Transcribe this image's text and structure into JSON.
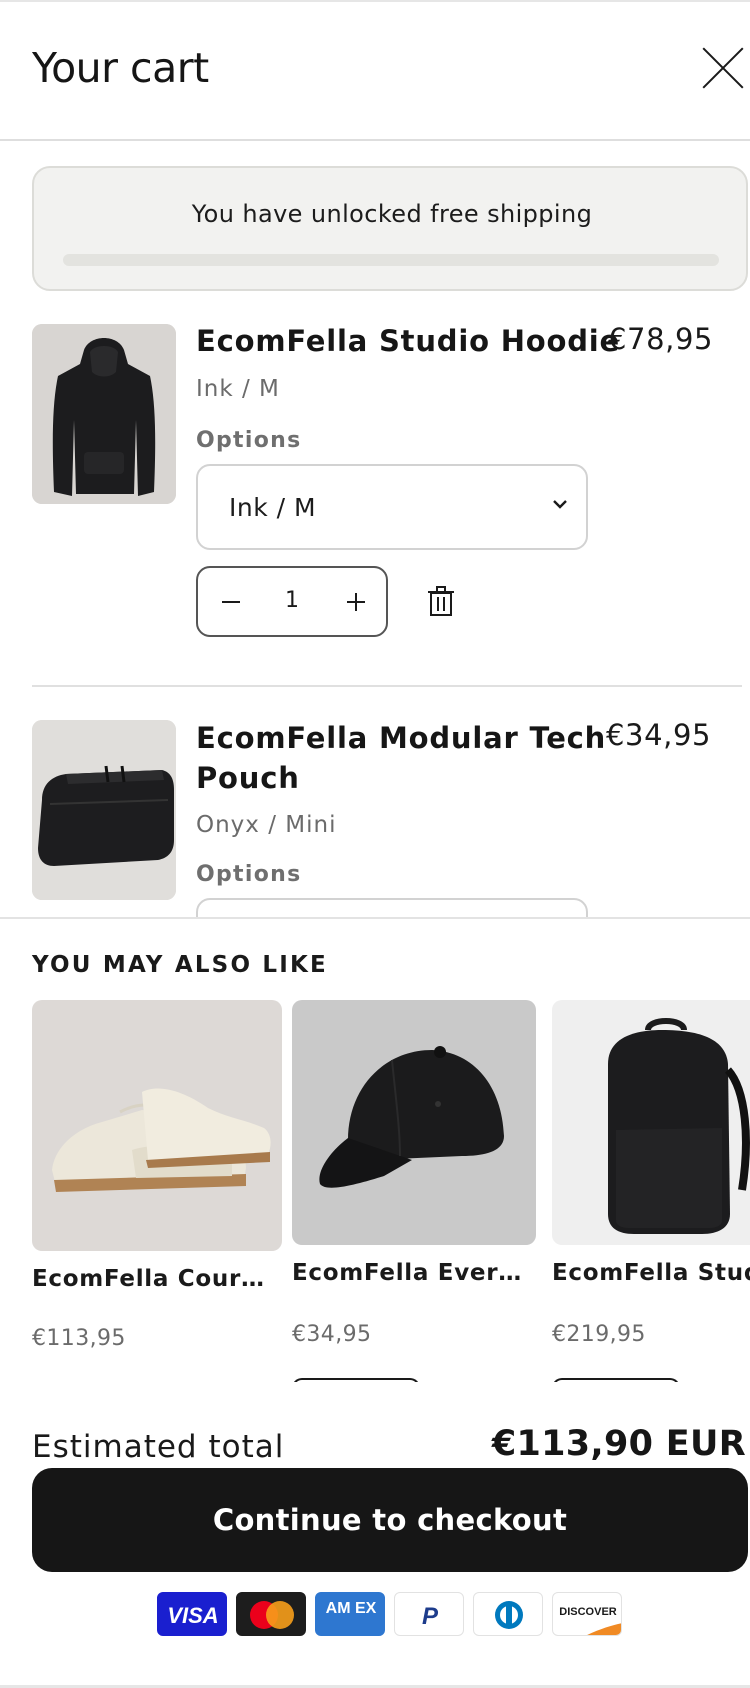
{
  "header": {
    "title": "Your cart"
  },
  "shipping_banner": {
    "text": "You have unlocked free shipping",
    "progress": 1.0
  },
  "cart_items": [
    {
      "title": "EcomFella Studio Hoodie",
      "price": "€78,95",
      "variant": "Ink / M",
      "options_label": "Options",
      "selected_option": "Ink / M",
      "quantity": "1",
      "image_icon": "hoodie-icon"
    },
    {
      "title_line1": "EcomFella Modular Tech",
      "title_line2": "Pouch",
      "price": "€34,95",
      "variant": "Onyx / Mini",
      "options_label": "Options",
      "image_icon": "pouch-icon"
    }
  ],
  "recommendations": {
    "heading": "YOU MAY ALSO LIKE",
    "items": [
      {
        "name": "EcomFella Court ...",
        "price": "€113,95",
        "image_icon": "sneaker-icon"
      },
      {
        "name": "EcomFella Every...",
        "price": "€34,95",
        "image_icon": "cap-icon"
      },
      {
        "name": "EcomFella Stud",
        "price": "€219,95",
        "image_icon": "backpack-icon"
      }
    ]
  },
  "footer": {
    "total_label": "Estimated total",
    "total_value": "€113,90 EUR",
    "checkout_label": "Continue to checkout"
  },
  "payment_methods": [
    {
      "name": "visa-icon",
      "label": "VISA"
    },
    {
      "name": "mastercard-icon",
      "label": ""
    },
    {
      "name": "amex-icon",
      "label": "AM EX"
    },
    {
      "name": "paypal-icon",
      "label": "P"
    },
    {
      "name": "diners-club-icon",
      "label": ""
    },
    {
      "name": "discover-icon",
      "label": "DISCOVER"
    }
  ],
  "colors": {
    "primary": "#161616",
    "muted_text": "#6b6b6b",
    "banner_bg": "#f2f2f0",
    "visa_blue": "#1a1fcf",
    "amex_blue": "#2e77d0",
    "discover_orange": "#f08a24"
  }
}
